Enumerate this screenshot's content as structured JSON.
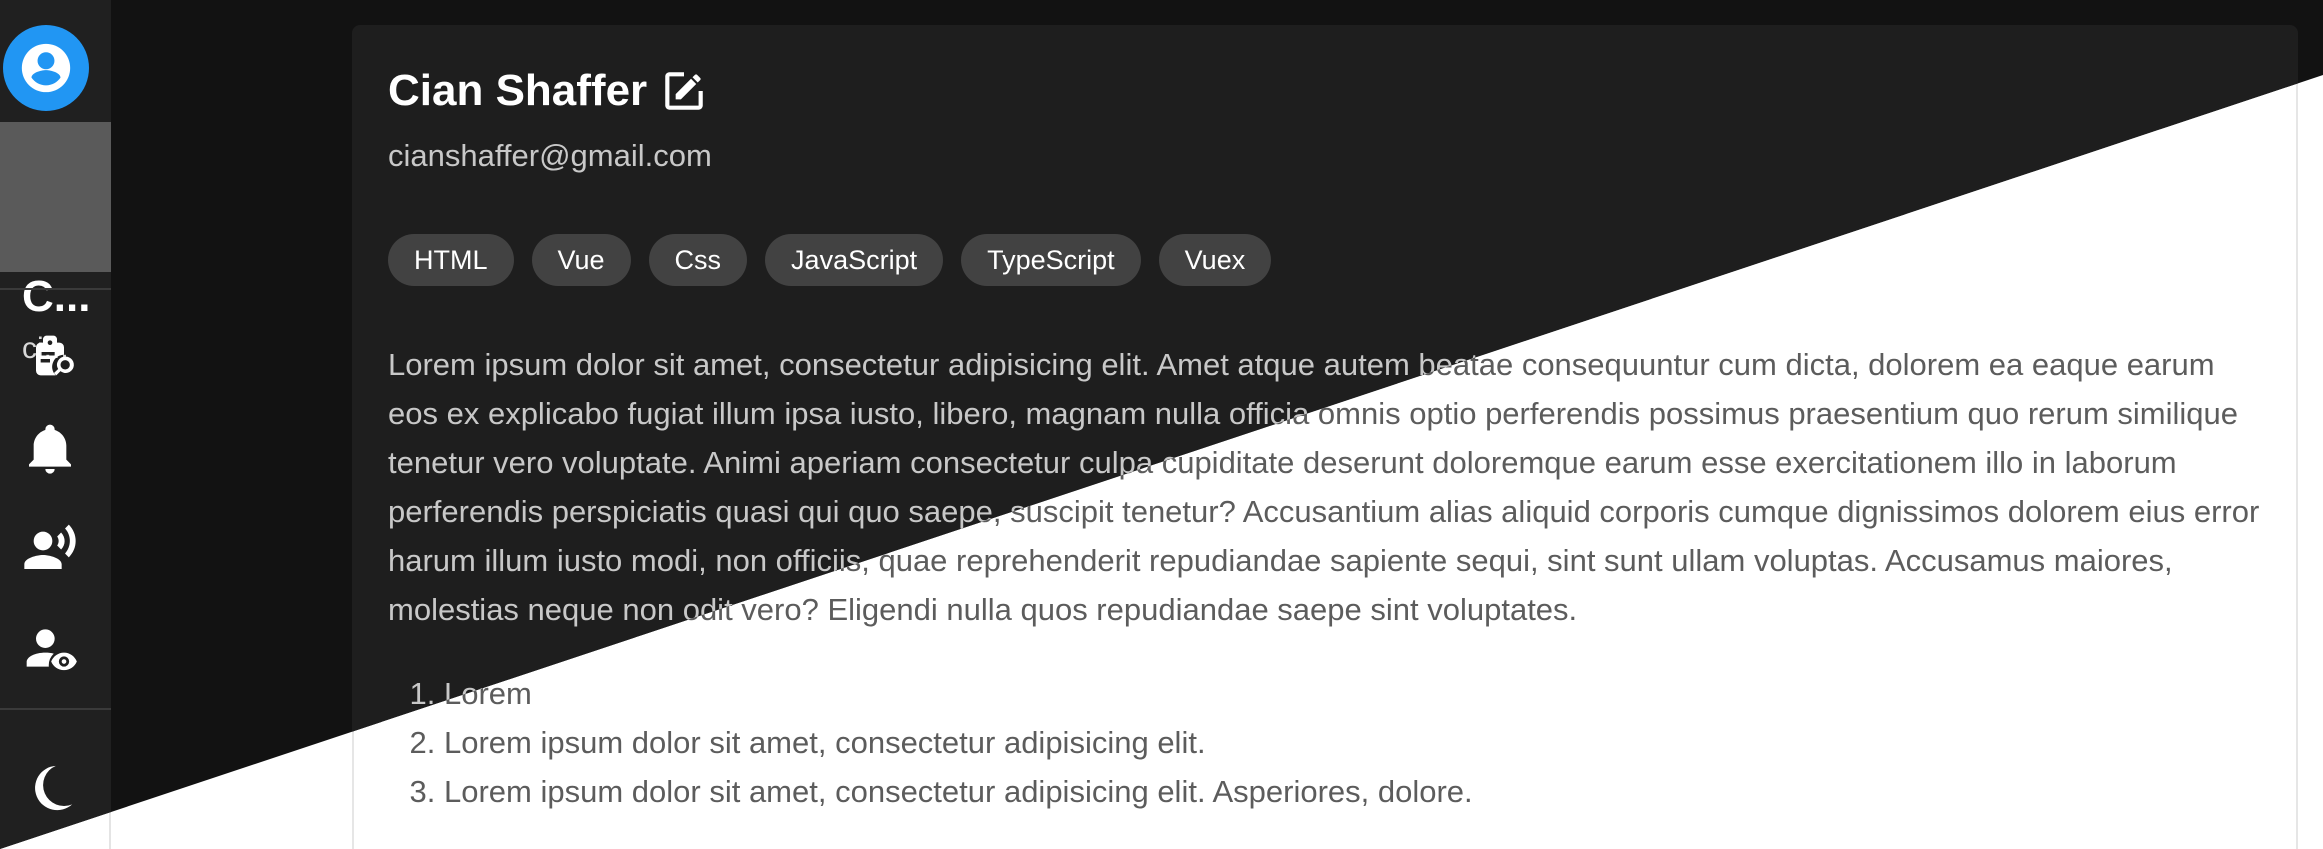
{
  "sidebar": {
    "avatar_icon": "account-circle-icon",
    "user_name": "C...",
    "user_email": "ci...",
    "nav_icons": [
      "clipboard-search-icon",
      "bell-icon",
      "account-voice-icon",
      "account-eye-icon",
      "moon-icon"
    ]
  },
  "profile": {
    "name": "Cian Shaffer",
    "email": "cianshaffer@gmail.com",
    "skills": [
      "HTML",
      "Vue",
      "Css",
      "JavaScript",
      "TypeScript",
      "Vuex"
    ],
    "bio": "Lorem ipsum dolor sit amet, consectetur adipisicing elit. Amet atque autem beatae consequuntur cum dicta, dolorem ea eaque earum eos ex explicabo fugiat illum ipsa iusto, libero, magnam nulla officia omnis optio perferendis possimus praesentium quo rerum similique tenetur vero voluptate. Animi aperiam consectetur culpa cupiditate deserunt doloremque earum esse exercitationem illo in laborum perferendis perspiciatis quasi qui quo saepe, suscipit tenetur? Accusantium alias aliquid corporis cumque dignissimos dolorem eius error harum illum iusto modi, non officiis, quae reprehenderit repudiandae sapiente sequi, sint sunt ullam voluptas. Accusamus maiores, molestias neque non odit vero? Eligendi nulla quos repudiandae saepe sint voluptates.",
    "list": [
      "Lorem",
      "Lorem ipsum dolor sit amet, consectetur adipisicing elit.",
      "Lorem ipsum dolor sit amet, consectetur adipisicing elit. Asperiores, dolore."
    ]
  },
  "colors": {
    "accent": "#2196f3",
    "dark_bg": "#121212",
    "dark_card": "#1e1e1e",
    "light_bg": "#ffffff"
  }
}
